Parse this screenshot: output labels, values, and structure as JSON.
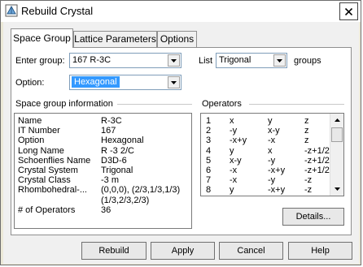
{
  "window": {
    "title": "Rebuild Crystal"
  },
  "tabs": [
    {
      "label": "Space Group",
      "active": true
    },
    {
      "label": "Lattice Parameters",
      "active": false
    },
    {
      "label": "Options",
      "active": false
    }
  ],
  "enter_group": {
    "label": "Enter group:",
    "value": "167  R-3C"
  },
  "list_filter": {
    "label": "List",
    "value": "Trigonal",
    "suffix": "groups"
  },
  "option": {
    "label": "Option:",
    "value": "Hexagonal"
  },
  "info": {
    "heading": "Space group information",
    "rows": [
      [
        "Name",
        "R-3C"
      ],
      [
        "IT Number",
        "167"
      ],
      [
        "Option",
        "Hexagonal"
      ],
      [
        "Long Name",
        "R -3 2/C"
      ],
      [
        "Schoenflies Name",
        "D3D-6"
      ],
      [
        "Crystal System",
        "Trigonal"
      ],
      [
        "Crystal Class",
        "-3 m"
      ],
      [
        "Rhombohedral-...",
        "(0,0,0), (2/3,1/3,1/3)"
      ],
      [
        "",
        "(1/3,2/3,2/3)"
      ],
      [
        "# of Operators",
        "36"
      ]
    ]
  },
  "operators": {
    "heading": "Operators",
    "rows": [
      [
        "1",
        "x",
        "y",
        "z"
      ],
      [
        "2",
        "-y",
        "x-y",
        "z"
      ],
      [
        "3",
        "-x+y",
        "-x",
        "z"
      ],
      [
        "4",
        "y",
        "x",
        "-z+1/2"
      ],
      [
        "5",
        "x-y",
        "-y",
        "-z+1/2"
      ],
      [
        "6",
        "-x",
        "-x+y",
        "-z+1/2"
      ],
      [
        "7",
        "-x",
        "-y",
        "-z"
      ],
      [
        "8",
        "y",
        "-x+y",
        "-z"
      ]
    ]
  },
  "buttons": {
    "details": "Details...",
    "rebuild": "Rebuild",
    "apply": "Apply",
    "cancel": "Cancel",
    "help": "Help"
  }
}
